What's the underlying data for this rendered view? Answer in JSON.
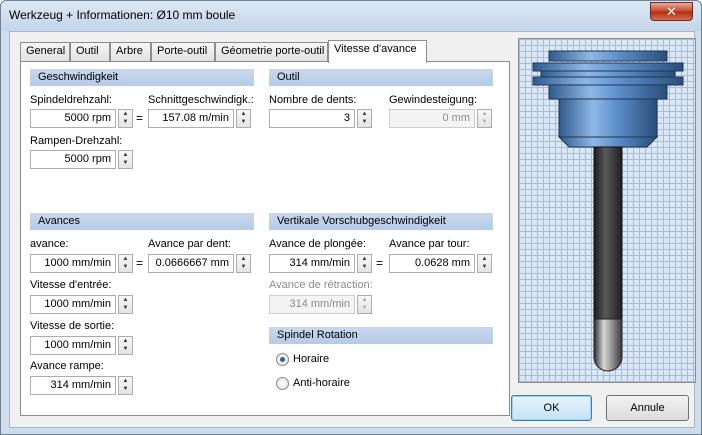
{
  "window": {
    "title": "Werkzeug + Informationen: Ø10 mm boule",
    "close_label": "✕"
  },
  "tabs": [
    "General",
    "Outil",
    "Arbre",
    "Porte-outil",
    "Géometrie porte-outil",
    "Vitesse d'avance"
  ],
  "active_tab": "Vitesse d'avance",
  "geschwindigkeit": {
    "header": "Geschwindigkeit",
    "spindle_label": "Spindeldrehzahl:",
    "spindle_value": "5000 rpm",
    "cut_speed_label": "Schnittgeschwindigk.:",
    "cut_speed_value": "157.08 m/min",
    "ramp_rpm_label": "Rampen-Drehzahl:",
    "ramp_rpm_value": "5000 rpm",
    "eq": "="
  },
  "outil": {
    "header": "Outil",
    "teeth_label": "Nombre de dents:",
    "teeth_value": "3",
    "pitch_label": "Gewindesteigung:",
    "pitch_value": "0 mm"
  },
  "avances": {
    "header": "Avances",
    "feed_label": "avance:",
    "feed_value": "1000 mm/min",
    "per_tooth_label": "Avance par dent:",
    "per_tooth_value": "0.0666667 mm",
    "entry_label": "Vitesse d'entrée:",
    "entry_value": "1000 mm/min",
    "exit_label": "Vitesse de sortie:",
    "exit_value": "1000 mm/min",
    "ramp_label": "Avance rampe:",
    "ramp_value": "314 mm/min",
    "eq": "="
  },
  "vertical": {
    "header": "Vertikale Vorschubgeschwindigkeit",
    "plunge_label": "Avance de plongée:",
    "plunge_value": "314 mm/min",
    "per_rev_label": "Avance par tour:",
    "per_rev_value": "0.0628 mm",
    "retract_label": "Avance de rétraction:",
    "retract_value": "314 mm/min",
    "eq": "="
  },
  "rotation": {
    "header": "Spindel Rotation",
    "clockwise_label": "Horaire",
    "counter_label": "Anti-horaire",
    "selected": "Horaire"
  },
  "buttons": {
    "ok": "OK",
    "cancel": "Annule"
  },
  "colors": {
    "section_header": "#b7cbe6",
    "tool_body": "#5b8cc7",
    "shank": "#3c3c3c"
  }
}
